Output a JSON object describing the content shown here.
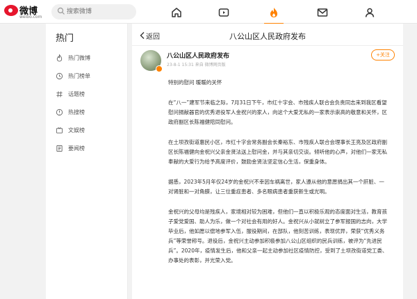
{
  "brand": {
    "name": "微博",
    "sub": "weibo.com",
    "color": "#e6162d"
  },
  "accent": "#ff8200",
  "search": {
    "placeholder": "搜索微博"
  },
  "nav": [
    {
      "icon": "home-icon"
    },
    {
      "icon": "video-icon"
    },
    {
      "icon": "hot-flame-icon",
      "active": true
    },
    {
      "icon": "message-icon"
    },
    {
      "icon": "profile-icon"
    }
  ],
  "sidebar": {
    "title": "热门",
    "items": [
      {
        "label": "热门微博",
        "icon": "fire-icon"
      },
      {
        "label": "热门榜单",
        "icon": "list-icon"
      },
      {
        "label": "话题榜",
        "icon": "hashtag-icon"
      },
      {
        "label": "热搜榜",
        "icon": "hotsearch-icon"
      },
      {
        "label": "文娱榜",
        "icon": "entertainment-icon"
      },
      {
        "label": "要闻榜",
        "icon": "news-icon"
      }
    ]
  },
  "header": {
    "back_label": "返回",
    "title": "八公山区人民政府发布"
  },
  "post": {
    "author": "八公山区人民政府发布",
    "meta": "23-8-1 15:31  来自 微博网页版",
    "follow_label": "+关注",
    "paragraphs": [
      "特别的慰问 暖暖的关怀",
      "在“八一”建军节来临之际，7月31日下午，市红十字会、市残疾人联合会负责同志来到我区看望慰问捐献器官的优秀退役军人金祝兴的家人，向这个大爱无私的一家表示崇高的敬意和关怀，区政府副区长陈福健陪同慰问。",
      "在土坝孜街道惠民小区，市红十字会常务副会长秦裕东、市残疾人联合会理事长王亮及区政府副区长陈福健向金祝兴父亲金贤法送上慰问金，并与其亲切交谈。倾听他的心声，对他们一家无私奉献的大爱行为给予高度评价，鼓励金贤法坚定信心生活，保重身体。",
      "据悉，2023年5月年仅24岁的金祝兴不幸因车祸离世，家人遵从他的意愿捐出其一个肝脏、一对肾脏和一对角膜，让三位重症患者、多名眼病患者重获新生或光明。",
      "金祝兴的父母均是残疾人，家境相对较为困难，但他们一直以积极乐观的态度面对生活，教育孩子爱党爱国、助人为乐，做一个对社会有用的好人。金祝兴从小就树立了参军报国的志向，大学毕业后，他如愿以偿地参军入伍，服役期间，在部队，他刻苦训练，表现优异，荣获“优秀义务兵”等荣誉称号。退役后，金祝兴主动参加积极参加八公山区组织的民兵训练，被评为“先进民兵”。2020年，疫情发生后，他和父亲一起主动参加社区疫情防控，受到了土坝孜街道党工委、办事处的表彰，并光荣入党。"
    ]
  }
}
